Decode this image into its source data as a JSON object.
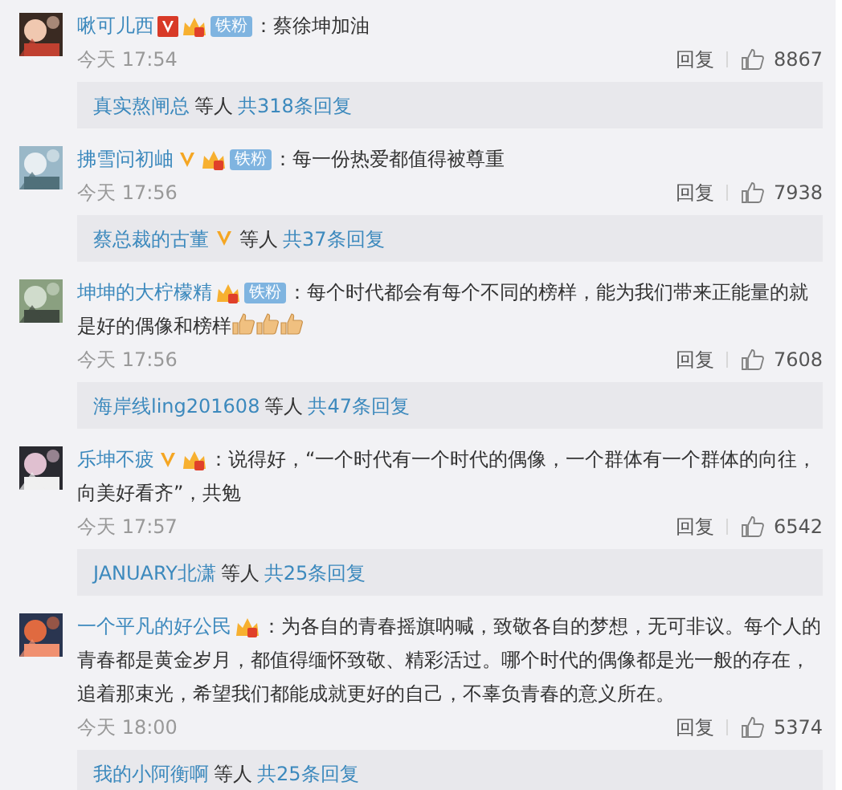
{
  "comments": [
    {
      "user": "啾可儿西",
      "verified": true,
      "verified_boxed": true,
      "crown": true,
      "fan_badge": "铁粉",
      "text": "：蔡徐坤加油",
      "time": "今天 17:54",
      "reply_label": "回复",
      "likes": "8867",
      "thread": {
        "user": "真实熬闸总",
        "others": "等人",
        "total": "共318条回复"
      }
    },
    {
      "user": "拂雪问初岫",
      "verified": true,
      "verified_boxed": false,
      "crown": true,
      "fan_badge": "铁粉",
      "text": "：每一份热爱都值得被尊重",
      "time": "今天 17:56",
      "reply_label": "回复",
      "likes": "7938",
      "thread": {
        "user": "蔡总裁的古董",
        "user_verified": true,
        "others": "等人",
        "total": "共37条回复"
      }
    },
    {
      "user": "坤坤的大柠檬精",
      "crown": true,
      "fan_badge": "铁粉",
      "text": "：每个时代都会有每个不同的榜样，能为我们带来正能量的就是好的偶像和榜样",
      "emoticons": [
        {
          "kind": "thumbs"
        },
        {
          "kind": "thumbs"
        },
        {
          "kind": "thumbs"
        }
      ],
      "time": "今天 17:56",
      "reply_label": "回复",
      "likes": "7608",
      "thread": {
        "user": "海岸线ling201608",
        "others": "等人",
        "total": "共47条回复"
      }
    },
    {
      "user": "乐坤不疲",
      "verified": true,
      "verified_boxed": false,
      "crown": true,
      "text": "：说得好，“一个时代有一个时代的偶像，一个群体有一个群体的向往，向美好看齐”，共勉",
      "time": "今天 17:57",
      "reply_label": "回复",
      "likes": "6542",
      "thread": {
        "user": "JANUARY北潇",
        "others": "等人",
        "total": "共25条回复"
      }
    },
    {
      "user": "一个平凡的好公民",
      "crown": true,
      "text": "：为各自的青春摇旗呐喊，致敬各自的梦想，无可非议。每个人的青春都是黄金岁月，都值得缅怀致敬、精彩活过。哪个时代的偶像都是光一般的存在，追着那束光，希望我们都能成就更好的自己，不辜负青春的意义所在。",
      "time": "今天 18:00",
      "reply_label": "回复",
      "likes": "5374",
      "thread": {
        "user": "我的小阿衡啊",
        "others": "等人",
        "total": "共25条回复"
      }
    }
  ]
}
